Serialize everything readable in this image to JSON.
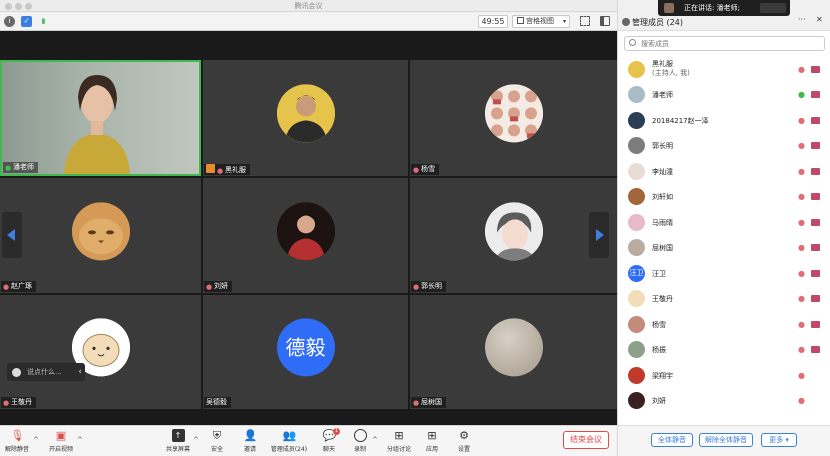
{
  "window": {
    "title": "腾讯会议"
  },
  "toolbar": {
    "timer": "49:55",
    "view_label": "宫格视图"
  },
  "speaking": {
    "text": "正在讲话: 潘老师;"
  },
  "tiles": [
    {
      "name": "潘老师"
    },
    {
      "name": "黑礼服"
    },
    {
      "name": "杨雪"
    },
    {
      "name": "赵广琢"
    },
    {
      "name": "刘妍"
    },
    {
      "name": "郭长明"
    },
    {
      "name": "王敬丹"
    },
    {
      "name": "吴德毅",
      "avatar_text": "德毅"
    },
    {
      "name": "屈树国"
    }
  ],
  "chat": {
    "placeholder": "说点什么..."
  },
  "bottom_bar": {
    "mute": "解除静音",
    "video": "开启视频",
    "share": "共享屏幕",
    "security": "安全",
    "invite": "邀请",
    "members": "管理成员(24)",
    "chat": "聊天",
    "chat_badge": "1",
    "record": "录制",
    "breakout": "分组讨论",
    "apps": "应用",
    "settings": "设置",
    "end": "结束会议"
  },
  "panel": {
    "title": "管理成员 (24)",
    "search_placeholder": "搜索成员",
    "members": [
      {
        "name": "黑礼服",
        "sub": "(主持人, 我)"
      },
      {
        "name": "潘老师"
      },
      {
        "name": "20184217赵一泽"
      },
      {
        "name": "郭长明"
      },
      {
        "name": "李灿潼"
      },
      {
        "name": "刘轩如"
      },
      {
        "name": "马雨晴"
      },
      {
        "name": "屈树国"
      },
      {
        "name": "汪卫",
        "avatar_text": "汪卫"
      },
      {
        "name": "王敬丹"
      },
      {
        "name": "杨雪"
      },
      {
        "name": "杨振"
      },
      {
        "name": "梁翔宇"
      },
      {
        "name": "刘妍"
      }
    ],
    "mute_all": "全体静音",
    "unmute_all": "解除全体静音",
    "more": "更多 ▾"
  },
  "colors": {
    "speaker_border": "#3fb950",
    "accent": "#3b7fe0",
    "end_red": "#e04a4a"
  }
}
